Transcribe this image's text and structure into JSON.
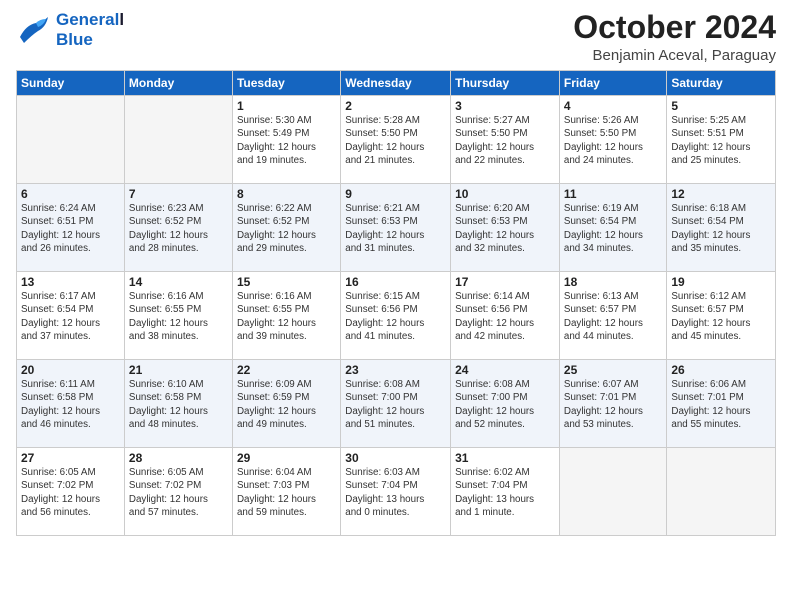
{
  "header": {
    "logo_line1": "General",
    "logo_line2": "Blue",
    "month_title": "October 2024",
    "subtitle": "Benjamin Aceval, Paraguay"
  },
  "weekdays": [
    "Sunday",
    "Monday",
    "Tuesday",
    "Wednesday",
    "Thursday",
    "Friday",
    "Saturday"
  ],
  "weeks": [
    [
      {
        "day": "",
        "detail": ""
      },
      {
        "day": "",
        "detail": ""
      },
      {
        "day": "1",
        "detail": "Sunrise: 5:30 AM\nSunset: 5:49 PM\nDaylight: 12 hours\nand 19 minutes."
      },
      {
        "day": "2",
        "detail": "Sunrise: 5:28 AM\nSunset: 5:50 PM\nDaylight: 12 hours\nand 21 minutes."
      },
      {
        "day": "3",
        "detail": "Sunrise: 5:27 AM\nSunset: 5:50 PM\nDaylight: 12 hours\nand 22 minutes."
      },
      {
        "day": "4",
        "detail": "Sunrise: 5:26 AM\nSunset: 5:50 PM\nDaylight: 12 hours\nand 24 minutes."
      },
      {
        "day": "5",
        "detail": "Sunrise: 5:25 AM\nSunset: 5:51 PM\nDaylight: 12 hours\nand 25 minutes."
      }
    ],
    [
      {
        "day": "6",
        "detail": "Sunrise: 6:24 AM\nSunset: 6:51 PM\nDaylight: 12 hours\nand 26 minutes."
      },
      {
        "day": "7",
        "detail": "Sunrise: 6:23 AM\nSunset: 6:52 PM\nDaylight: 12 hours\nand 28 minutes."
      },
      {
        "day": "8",
        "detail": "Sunrise: 6:22 AM\nSunset: 6:52 PM\nDaylight: 12 hours\nand 29 minutes."
      },
      {
        "day": "9",
        "detail": "Sunrise: 6:21 AM\nSunset: 6:53 PM\nDaylight: 12 hours\nand 31 minutes."
      },
      {
        "day": "10",
        "detail": "Sunrise: 6:20 AM\nSunset: 6:53 PM\nDaylight: 12 hours\nand 32 minutes."
      },
      {
        "day": "11",
        "detail": "Sunrise: 6:19 AM\nSunset: 6:54 PM\nDaylight: 12 hours\nand 34 minutes."
      },
      {
        "day": "12",
        "detail": "Sunrise: 6:18 AM\nSunset: 6:54 PM\nDaylight: 12 hours\nand 35 minutes."
      }
    ],
    [
      {
        "day": "13",
        "detail": "Sunrise: 6:17 AM\nSunset: 6:54 PM\nDaylight: 12 hours\nand 37 minutes."
      },
      {
        "day": "14",
        "detail": "Sunrise: 6:16 AM\nSunset: 6:55 PM\nDaylight: 12 hours\nand 38 minutes."
      },
      {
        "day": "15",
        "detail": "Sunrise: 6:16 AM\nSunset: 6:55 PM\nDaylight: 12 hours\nand 39 minutes."
      },
      {
        "day": "16",
        "detail": "Sunrise: 6:15 AM\nSunset: 6:56 PM\nDaylight: 12 hours\nand 41 minutes."
      },
      {
        "day": "17",
        "detail": "Sunrise: 6:14 AM\nSunset: 6:56 PM\nDaylight: 12 hours\nand 42 minutes."
      },
      {
        "day": "18",
        "detail": "Sunrise: 6:13 AM\nSunset: 6:57 PM\nDaylight: 12 hours\nand 44 minutes."
      },
      {
        "day": "19",
        "detail": "Sunrise: 6:12 AM\nSunset: 6:57 PM\nDaylight: 12 hours\nand 45 minutes."
      }
    ],
    [
      {
        "day": "20",
        "detail": "Sunrise: 6:11 AM\nSunset: 6:58 PM\nDaylight: 12 hours\nand 46 minutes."
      },
      {
        "day": "21",
        "detail": "Sunrise: 6:10 AM\nSunset: 6:58 PM\nDaylight: 12 hours\nand 48 minutes."
      },
      {
        "day": "22",
        "detail": "Sunrise: 6:09 AM\nSunset: 6:59 PM\nDaylight: 12 hours\nand 49 minutes."
      },
      {
        "day": "23",
        "detail": "Sunrise: 6:08 AM\nSunset: 7:00 PM\nDaylight: 12 hours\nand 51 minutes."
      },
      {
        "day": "24",
        "detail": "Sunrise: 6:08 AM\nSunset: 7:00 PM\nDaylight: 12 hours\nand 52 minutes."
      },
      {
        "day": "25",
        "detail": "Sunrise: 6:07 AM\nSunset: 7:01 PM\nDaylight: 12 hours\nand 53 minutes."
      },
      {
        "day": "26",
        "detail": "Sunrise: 6:06 AM\nSunset: 7:01 PM\nDaylight: 12 hours\nand 55 minutes."
      }
    ],
    [
      {
        "day": "27",
        "detail": "Sunrise: 6:05 AM\nSunset: 7:02 PM\nDaylight: 12 hours\nand 56 minutes."
      },
      {
        "day": "28",
        "detail": "Sunrise: 6:05 AM\nSunset: 7:02 PM\nDaylight: 12 hours\nand 57 minutes."
      },
      {
        "day": "29",
        "detail": "Sunrise: 6:04 AM\nSunset: 7:03 PM\nDaylight: 12 hours\nand 59 minutes."
      },
      {
        "day": "30",
        "detail": "Sunrise: 6:03 AM\nSunset: 7:04 PM\nDaylight: 13 hours\nand 0 minutes."
      },
      {
        "day": "31",
        "detail": "Sunrise: 6:02 AM\nSunset: 7:04 PM\nDaylight: 13 hours\nand 1 minute."
      },
      {
        "day": "",
        "detail": ""
      },
      {
        "day": "",
        "detail": ""
      }
    ]
  ]
}
